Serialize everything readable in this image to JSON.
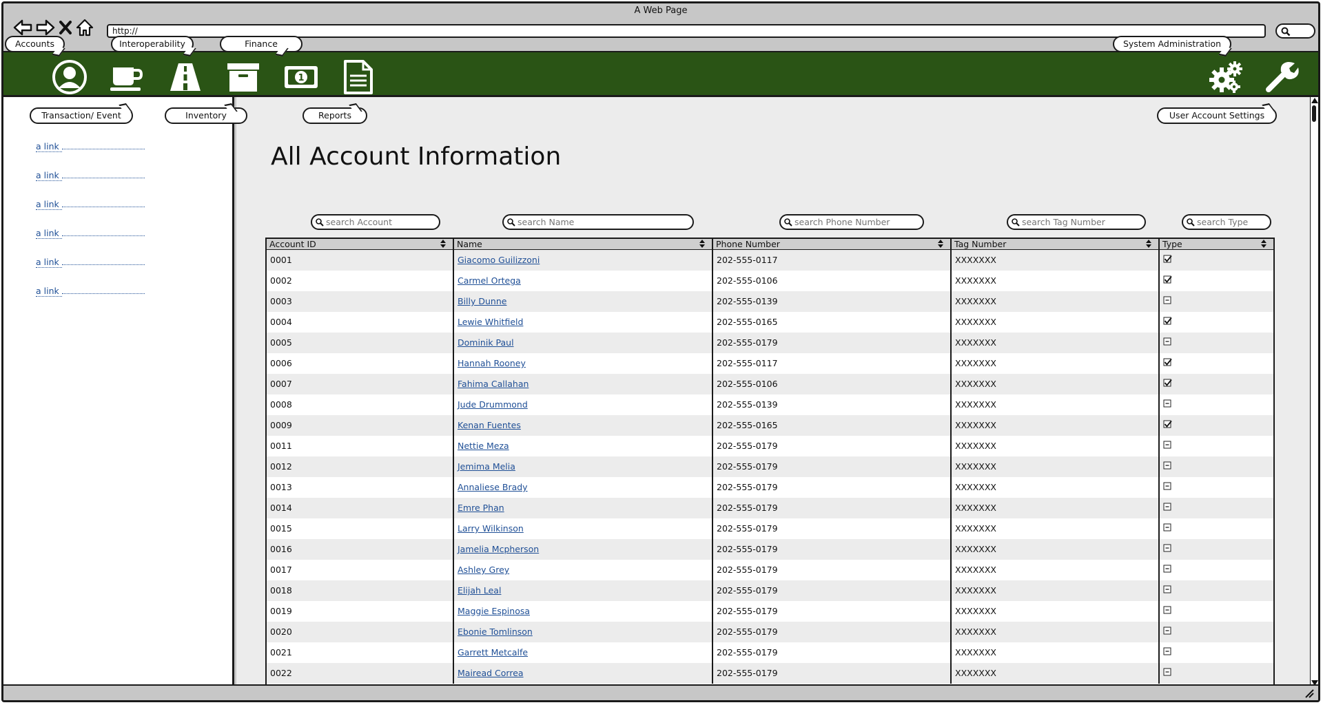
{
  "window": {
    "title": "A Web Page",
    "url": "http://"
  },
  "top_tabs": {
    "accounts": "Accounts",
    "interoperability": "Interoperability",
    "finance": "Finance",
    "system_administration": "System Administration"
  },
  "sub_tabs": {
    "transaction": "Transaction/ Event",
    "inventory": "Inventory",
    "reports": "Reports",
    "user_account_settings": "User Account Settings"
  },
  "sidebar": {
    "links": [
      "a link",
      "a link",
      "a link",
      "a link",
      "a link",
      "a link"
    ]
  },
  "main": {
    "title": "All Account Information"
  },
  "filters": {
    "account": "search Account",
    "name": "search Name",
    "phone": "search Phone Number",
    "tag": "search Tag Number",
    "type": "search Type"
  },
  "table": {
    "headers": [
      "Account ID",
      "Name",
      "Phone Number",
      "Tag Number",
      "Type"
    ],
    "rows": [
      {
        "id": "0001",
        "name": "Giacomo Guilizzoni",
        "phone": "202-555-0117",
        "tag": "XXXXXXX",
        "checked": true
      },
      {
        "id": "0002",
        "name": "Carmel Ortega",
        "phone": "202-555-0106",
        "tag": "XXXXXXX",
        "checked": true
      },
      {
        "id": "0003",
        "name": "Billy Dunne",
        "phone": "202-555-0139",
        "tag": "XXXXXXX",
        "checked": false
      },
      {
        "id": "0004",
        "name": "Lewie Whitfield",
        "phone": "202-555-0165",
        "tag": "XXXXXXX",
        "checked": true
      },
      {
        "id": "0005",
        "name": "Dominik Paul",
        "phone": "202-555-0179",
        "tag": "XXXXXXX",
        "checked": false
      },
      {
        "id": "0006",
        "name": "Hannah Rooney",
        "phone": "202-555-0117",
        "tag": "XXXXXXX",
        "checked": true
      },
      {
        "id": "0007",
        "name": "Fahima Callahan",
        "phone": "202-555-0106",
        "tag": "XXXXXXX",
        "checked": true
      },
      {
        "id": "0008",
        "name": "Jude Drummond",
        "phone": "202-555-0139",
        "tag": "XXXXXXX",
        "checked": false
      },
      {
        "id": "0009",
        "name": "Kenan Fuentes",
        "phone": "202-555-0165",
        "tag": "XXXXXXX",
        "checked": true
      },
      {
        "id": "0011",
        "name": "Nettie Meza",
        "phone": "202-555-0179",
        "tag": "XXXXXXX",
        "checked": false
      },
      {
        "id": "0012",
        "name": "Jemima Melia",
        "phone": "202-555-0179",
        "tag": "XXXXXXX",
        "checked": false
      },
      {
        "id": "0013",
        "name": "Annaliese Brady",
        "phone": "202-555-0179",
        "tag": "XXXXXXX",
        "checked": false
      },
      {
        "id": "0014",
        "name": "Emre Phan",
        "phone": "202-555-0179",
        "tag": "XXXXXXX",
        "checked": false
      },
      {
        "id": "0015",
        "name": "Larry Wilkinson",
        "phone": "202-555-0179",
        "tag": "XXXXXXX",
        "checked": false
      },
      {
        "id": "0016",
        "name": "Jamelia Mcpherson",
        "phone": "202-555-0179",
        "tag": "XXXXXXX",
        "checked": false
      },
      {
        "id": "0017",
        "name": "Ashley Grey",
        "phone": "202-555-0179",
        "tag": "XXXXXXX",
        "checked": false
      },
      {
        "id": "0018",
        "name": "Elijah Leal",
        "phone": "202-555-0179",
        "tag": "XXXXXXX",
        "checked": false
      },
      {
        "id": "0019",
        "name": "Maggie Espinosa",
        "phone": "202-555-0179",
        "tag": "XXXXXXX",
        "checked": false
      },
      {
        "id": "0020",
        "name": "Ebonie Tomlinson",
        "phone": "202-555-0179",
        "tag": "XXXXXXX",
        "checked": false
      },
      {
        "id": "0021",
        "name": "Garrett Metcalfe",
        "phone": "202-555-0179",
        "tag": "XXXXXXX",
        "checked": false
      },
      {
        "id": "0022",
        "name": "Mairead Correa",
        "phone": "202-555-0179",
        "tag": "XXXXXXX",
        "checked": false
      }
    ]
  },
  "icons": {
    "nav": [
      "back-arrow-icon",
      "forward-arrow-icon",
      "close-icon",
      "home-icon"
    ],
    "green": [
      "user-icon",
      "coffee-cup-icon",
      "road-icon",
      "archive-box-icon",
      "money-icon",
      "document-icon"
    ],
    "admin": [
      "gears-icon",
      "wrench-icon"
    ]
  },
  "colors": {
    "brand_green": "#2a5415",
    "link_blue": "#1f4f96"
  }
}
